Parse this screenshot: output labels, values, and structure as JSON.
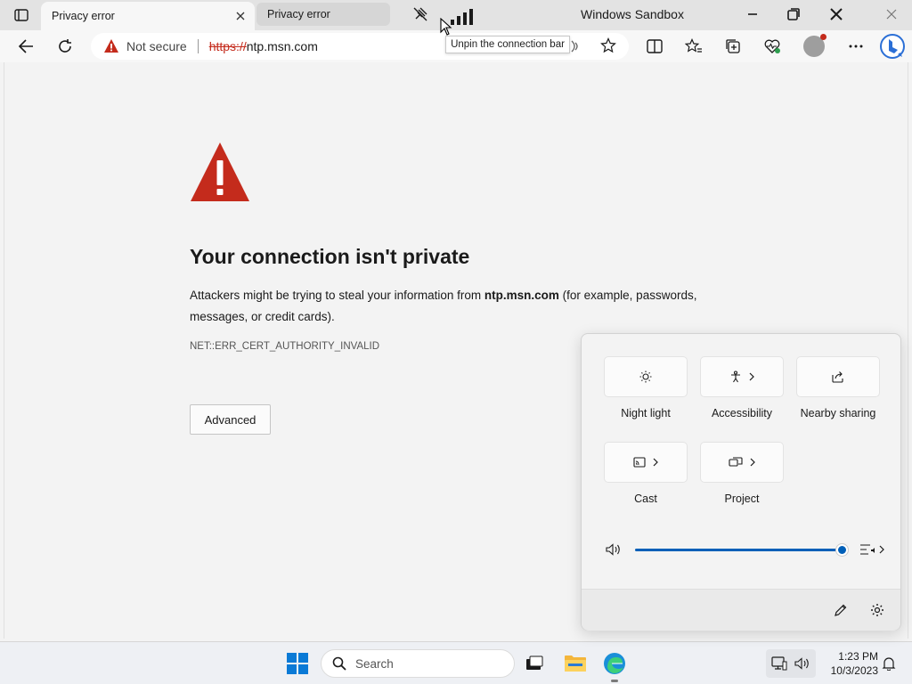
{
  "window": {
    "title": "Windows Sandbox",
    "tooltip": "Unpin the connection bar"
  },
  "tabs": [
    {
      "label": "Privacy error",
      "active": true
    },
    {
      "label": "Privacy error",
      "active": false
    }
  ],
  "toolbar": {
    "security_label": "Not secure",
    "url_scheme": "https://",
    "url_host": "ntp.msn.com"
  },
  "error_page": {
    "title": "Your connection isn't private",
    "body_prefix": "Attackers might be trying to steal your information from ",
    "body_host": "ntp.msn.com",
    "body_suffix": " (for example, passwords, messages, or credit cards).",
    "error_code": "NET::ERR_CERT_AUTHORITY_INVALID",
    "advanced_label": "Advanced"
  },
  "quick_settings": {
    "tiles": [
      {
        "label": "Night light",
        "icon": "brightness-icon",
        "has_chevron": false
      },
      {
        "label": "Accessibility",
        "icon": "accessibility-icon",
        "has_chevron": true
      },
      {
        "label": "Nearby sharing",
        "icon": "share-icon",
        "has_chevron": false
      },
      {
        "label": "Cast",
        "icon": "cast-icon",
        "has_chevron": true
      },
      {
        "label": "Project",
        "icon": "project-icon",
        "has_chevron": true
      }
    ],
    "volume_level": 1.0
  },
  "taskbar": {
    "search_placeholder": "Search",
    "time": "1:23 PM",
    "date": "10/3/2023"
  },
  "colors": {
    "warning_red": "#c42b1c",
    "accent_blue": "#005fb8"
  }
}
